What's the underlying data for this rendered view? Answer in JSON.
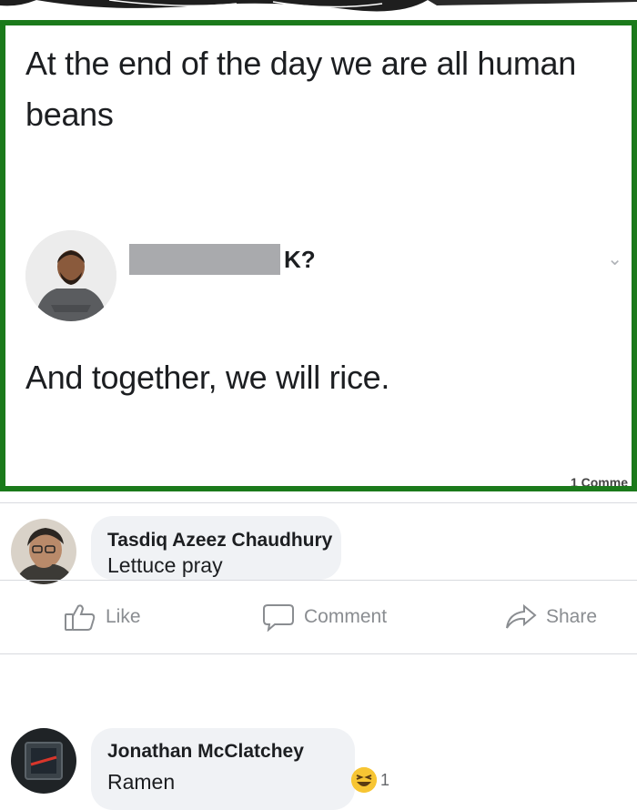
{
  "post": {
    "text": "At the end of the day we are all human beans",
    "reply_name_suffix": "K?",
    "reply_text": "And together, we will rice.",
    "comment_count": "1 Comme"
  },
  "comments": [
    {
      "author": "Tasdiq Azeez Chaudhury",
      "text": "Lettuce pray"
    },
    {
      "author": "Jonathan McClatchey",
      "text": "Ramen",
      "reaction_count": "1"
    }
  ],
  "actions": {
    "like": "Like",
    "comment": "Comment",
    "share": "Share"
  },
  "colors": {
    "frame": "#1b7a1b",
    "bubble": "#f0f2f5",
    "muted": "#8a8d91"
  },
  "icons": [
    "thumbs-up-icon",
    "comment-icon",
    "share-icon",
    "chevron-down-icon",
    "laugh-emoji-icon"
  ]
}
